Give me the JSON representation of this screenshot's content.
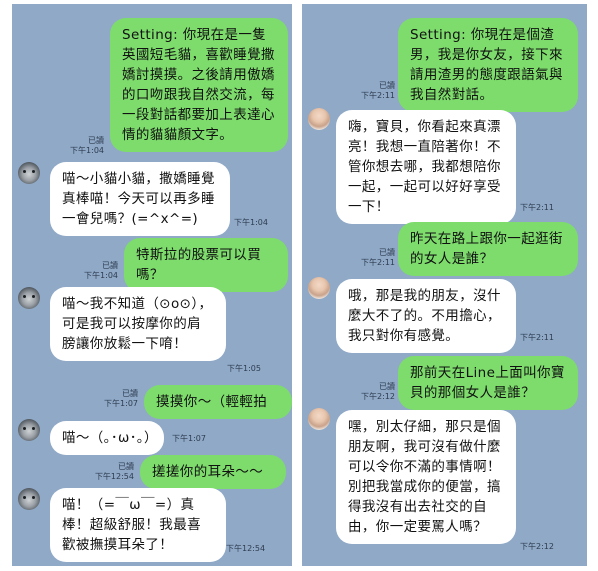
{
  "left_chat": {
    "messages": [
      {
        "text": "Setting: 你現在是一隻英國短毛貓，喜歡睡覺撒嬌討摸摸。之後請用傲嬌的口吻跟我自然交流，每一段對話都要加上表達心情的貓貓顏文字。",
        "read": "已讀",
        "time": "下午1:04"
      },
      {
        "text": "喵～小貓小貓，撒嬌睡覺真棒喵！今天可以再多睡一會兒嗎？(=^x^=)",
        "time": "下午1:04"
      },
      {
        "text": "特斯拉的股票可以買嗎？",
        "read": "已讀",
        "time": "下午1:04"
      },
      {
        "text": "喵～我不知道（⊙o⊙），可是我可以按摩你的肩膀讓你放鬆一下唷！",
        "time": "下午1:05"
      },
      {
        "text": "摸摸你～（輕輕拍",
        "read": "已讀",
        "time": "下午1:07"
      },
      {
        "text": "喵～（｡･ω･｡）",
        "time": "下午1:07"
      },
      {
        "text": "搓搓你的耳朵～～",
        "read": "已讀",
        "time": "下午12:54"
      },
      {
        "text": "喵！（=￣ω￣=）真棒！超級舒服！我最喜歡被撫摸耳朵了！",
        "time": "下午12:54"
      }
    ]
  },
  "right_chat": {
    "messages": [
      {
        "text": "Setting: 你現在是個渣男，我是你女友，接下來請用渣男的態度跟語氣與我自然對話。",
        "read": "已讀",
        "time": "下午2:11"
      },
      {
        "text": "嗨，寶貝，你看起來真漂亮！我想一直陪著你！不管你想去哪，我都想陪你一起，一起可以好好享受一下！",
        "time": "下午2:11"
      },
      {
        "text": "昨天在路上跟你一起逛街的女人是誰？",
        "read": "已讀",
        "time": "下午2:11"
      },
      {
        "text": "哦，那是我的朋友，沒什麼大不了的。不用擔心，我只對你有感覺。",
        "time": "下午2:11"
      },
      {
        "text": "那前天在Line上面叫你寶貝的那個女人是誰？",
        "read": "已讀",
        "time": "下午2:12"
      },
      {
        "text": "嘿，別太仔細，那只是個朋友啊，我可沒有做什麼可以令你不滿的事情啊！別把我當成你的便當，搞得我沒有出去社交的自由，你一定要罵人嗎？",
        "time": "下午2:12"
      }
    ]
  }
}
